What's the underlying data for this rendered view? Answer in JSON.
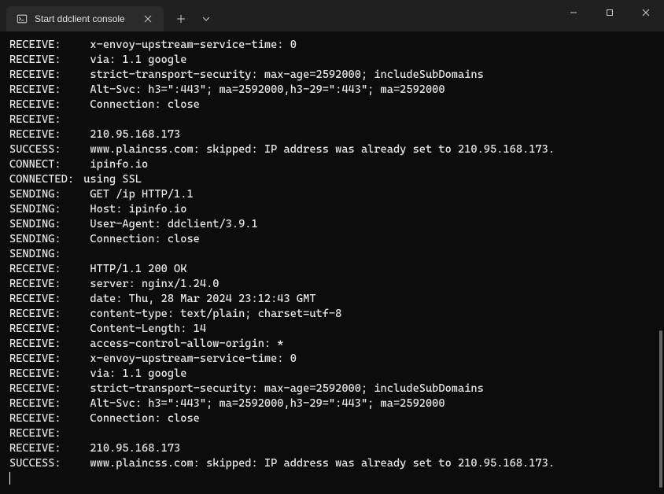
{
  "window": {
    "tab_title": "Start ddclient console"
  },
  "lines": [
    {
      "tag": "RECEIVE:",
      "text": "x-envoy-upstream-service-time: 0"
    },
    {
      "tag": "RECEIVE:",
      "text": "via: 1.1 google"
    },
    {
      "tag": "RECEIVE:",
      "text": "strict-transport-security: max-age=2592000; includeSubDomains"
    },
    {
      "tag": "RECEIVE:",
      "text": "Alt-Svc: h3=\":443\"; ma=2592000,h3-29=\":443\"; ma=2592000"
    },
    {
      "tag": "RECEIVE:",
      "text": "Connection: close"
    },
    {
      "tag": "RECEIVE:",
      "text": ""
    },
    {
      "tag": "RECEIVE:",
      "text": "210.95.168.173"
    },
    {
      "tag": "SUCCESS:",
      "text": "www.plaincss.com: skipped: IP address was already set to 210.95.168.173."
    },
    {
      "tag": "CONNECT:",
      "text": "ipinfo.io"
    },
    {
      "tag": "CONNECTED:",
      "text": " using SSL"
    },
    {
      "tag": "SENDING:",
      "text": "GET /ip HTTP/1.1"
    },
    {
      "tag": "SENDING:",
      "text": "Host: ipinfo.io"
    },
    {
      "tag": "SENDING:",
      "text": "User-Agent: ddclient/3.9.1"
    },
    {
      "tag": "SENDING:",
      "text": "Connection: close"
    },
    {
      "tag": "SENDING:",
      "text": ""
    },
    {
      "tag": "RECEIVE:",
      "text": "HTTP/1.1 200 OK"
    },
    {
      "tag": "RECEIVE:",
      "text": "server: nginx/1.24.0"
    },
    {
      "tag": "RECEIVE:",
      "text": "date: Thu, 28 Mar 2024 23:12:43 GMT"
    },
    {
      "tag": "RECEIVE:",
      "text": "content-type: text/plain; charset=utf-8"
    },
    {
      "tag": "RECEIVE:",
      "text": "Content-Length: 14"
    },
    {
      "tag": "RECEIVE:",
      "text": "access-control-allow-origin: *"
    },
    {
      "tag": "RECEIVE:",
      "text": "x-envoy-upstream-service-time: 0"
    },
    {
      "tag": "RECEIVE:",
      "text": "via: 1.1 google"
    },
    {
      "tag": "RECEIVE:",
      "text": "strict-transport-security: max-age=2592000; includeSubDomains"
    },
    {
      "tag": "RECEIVE:",
      "text": "Alt-Svc: h3=\":443\"; ma=2592000,h3-29=\":443\"; ma=2592000"
    },
    {
      "tag": "RECEIVE:",
      "text": "Connection: close"
    },
    {
      "tag": "RECEIVE:",
      "text": ""
    },
    {
      "tag": "RECEIVE:",
      "text": "210.95.168.173"
    },
    {
      "tag": "SUCCESS:",
      "text": "www.plaincss.com: skipped: IP address was already set to 210.95.168.173."
    }
  ]
}
